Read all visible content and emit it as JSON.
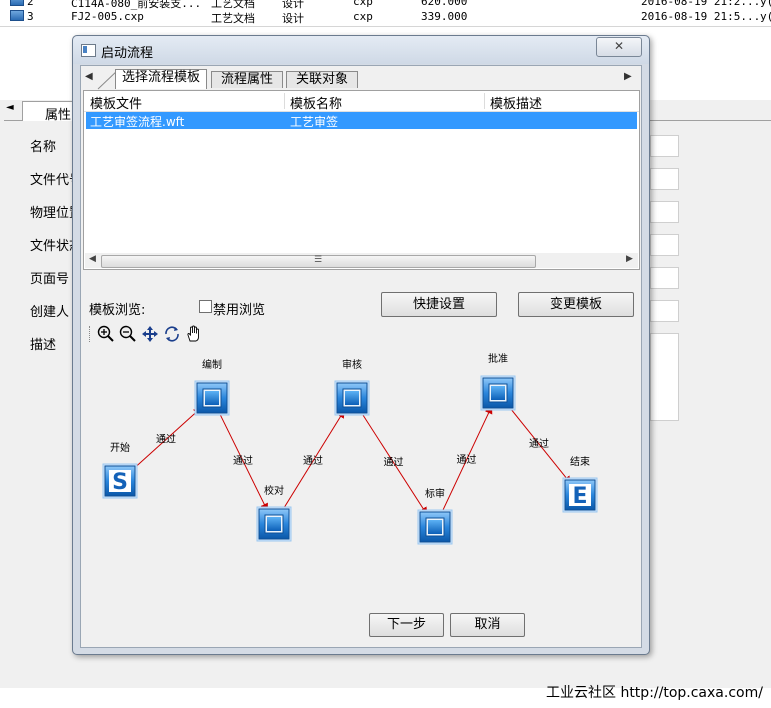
{
  "background": {
    "rows": [
      {
        "num": "2",
        "file": "C114A-080_前安装支...",
        "type": "工艺文档",
        "stage": "设计",
        "ext": "cxp",
        "size": "620.000",
        "date": "2016-08-19 21:2...",
        "extra": "y("
      },
      {
        "num": "3",
        "file": "FJ2-005.cxp",
        "type": "工艺文档",
        "stage": "设计",
        "ext": "cxp",
        "size": "339.000",
        "date": "2016-08-19 21:5...",
        "extra": "y("
      }
    ],
    "panel_tab": "属性",
    "field_labels": [
      "名称",
      "文件代号",
      "物理位置",
      "文件状态",
      "页面号",
      "创建人",
      "描述"
    ]
  },
  "dialog": {
    "title": "启动流程",
    "tabs": [
      "选择流程模板",
      "流程属性",
      "关联对象"
    ],
    "active_tab": 0,
    "list": {
      "columns": [
        "模板文件",
        "模板名称",
        "模板描述"
      ],
      "rows": [
        {
          "file": "工艺审签流程.wft",
          "name": "工艺审签",
          "desc": "",
          "selected": true
        }
      ]
    },
    "preview_label": "模板浏览:",
    "disable_preview_label": "禁用浏览",
    "disable_preview_checked": false,
    "quick_settings_button": "快捷设置",
    "change_template_button": "变更模板",
    "toolbar_icons": [
      "zoom-in-icon",
      "zoom-out-icon",
      "pan-icon",
      "refresh-icon",
      "hand-icon"
    ],
    "workflow": {
      "nodes": [
        {
          "id": "start",
          "label": "开始",
          "kind": "start"
        },
        {
          "id": "compile",
          "label": "编制",
          "kind": "task"
        },
        {
          "id": "proofread",
          "label": "校对",
          "kind": "task"
        },
        {
          "id": "review",
          "label": "审核",
          "kind": "task"
        },
        {
          "id": "standardize",
          "label": "标审",
          "kind": "task"
        },
        {
          "id": "approve",
          "label": "批准",
          "kind": "task"
        },
        {
          "id": "end",
          "label": "结束",
          "kind": "end"
        }
      ],
      "edge_label": "通过",
      "edges": [
        [
          "start",
          "compile"
        ],
        [
          "compile",
          "proofread"
        ],
        [
          "proofread",
          "review"
        ],
        [
          "review",
          "standardize"
        ],
        [
          "standardize",
          "approve"
        ],
        [
          "approve",
          "end"
        ]
      ],
      "start_glyph": "S",
      "end_glyph": "E"
    },
    "next_button": "下一步",
    "cancel_button": "取消"
  },
  "watermark": "工业云社区 http://top.caxa.com/",
  "colors": {
    "selection": "#3399ff",
    "edge": "#cc0000",
    "node": "#1f78d1"
  }
}
